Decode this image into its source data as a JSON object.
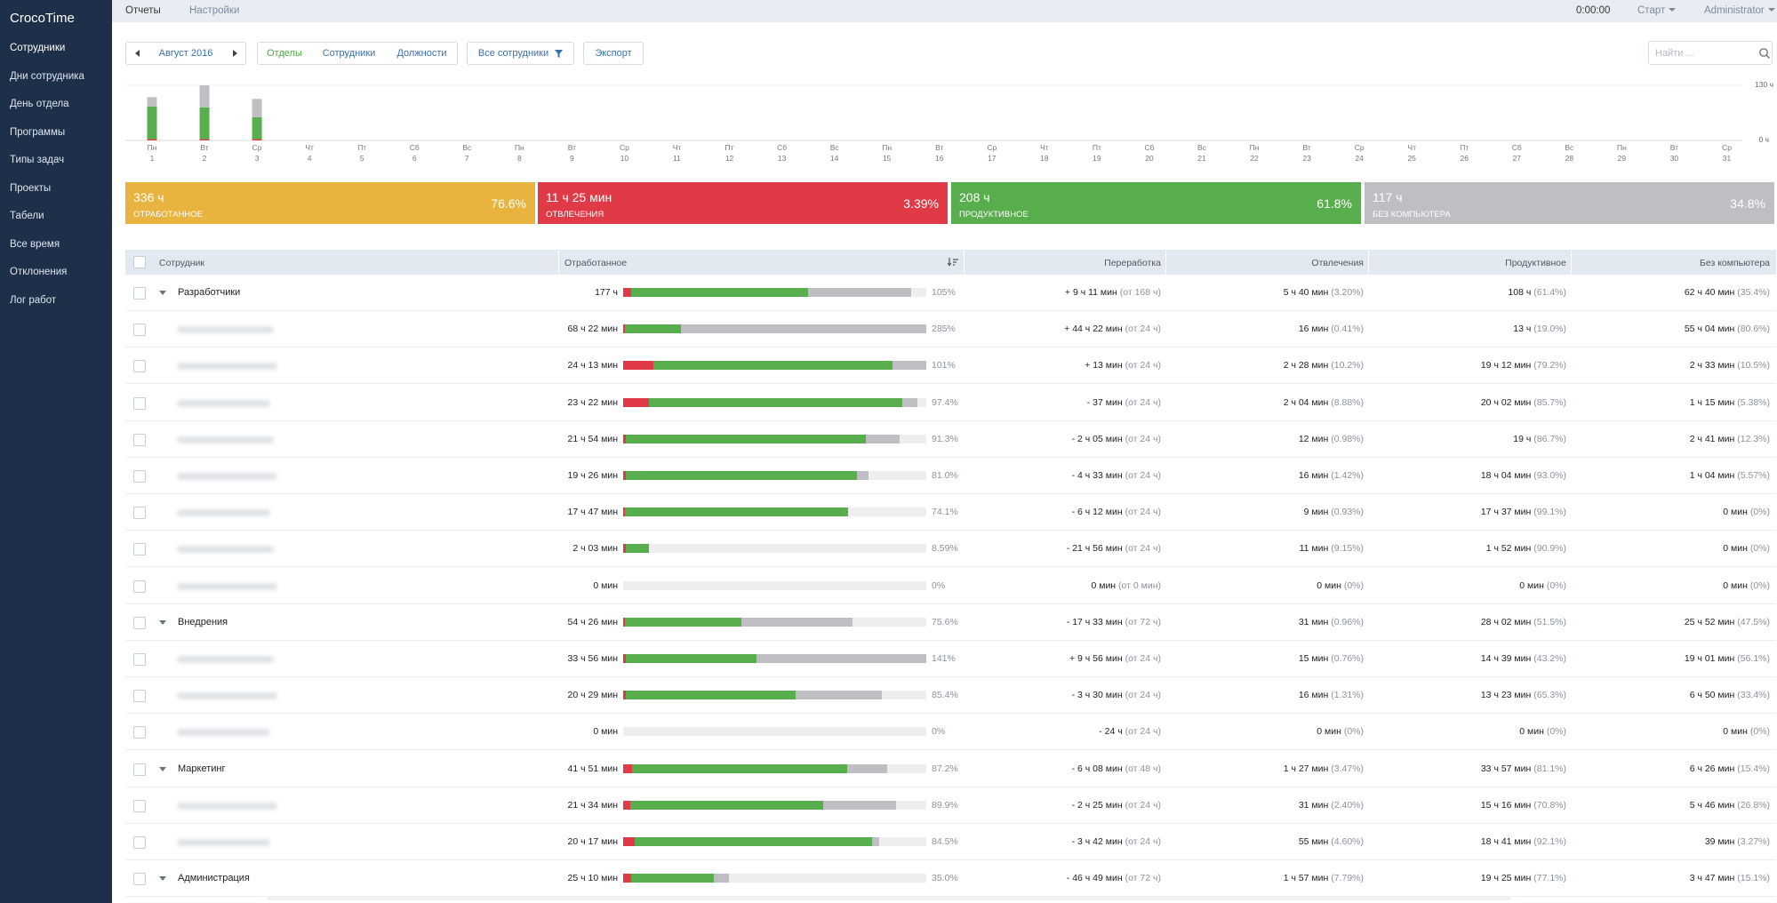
{
  "app": {
    "title": "CrocoTime"
  },
  "sidebar": {
    "items": [
      {
        "label": "Сотрудники",
        "active": true
      },
      {
        "label": "Дни сотрудника"
      },
      {
        "label": "День отдела"
      },
      {
        "label": "Программы"
      },
      {
        "label": "Типы задач"
      },
      {
        "label": "Проекты"
      },
      {
        "label": "Табели"
      },
      {
        "label": "Все время"
      },
      {
        "label": "Отклонения"
      },
      {
        "label": "Лог работ"
      }
    ]
  },
  "topbar": {
    "tabs": [
      "Отчеты",
      "Настройки"
    ],
    "timer": "0:00:00",
    "start": "Старт",
    "user": "Administrator"
  },
  "toolbar": {
    "month": "Август 2016",
    "views": [
      "Отделы",
      "Сотрудники",
      "Должности"
    ],
    "filter": "Все сотрудники",
    "export": "Экспорт",
    "search_placeholder": "Найти ..."
  },
  "colors": {
    "work": "#e8b33e",
    "distraction": "#e03a46",
    "productive": "#58ad4c",
    "no_computer": "#bfbfc3"
  },
  "chart_data": {
    "type": "bar",
    "stacked": true,
    "ymax_label": "130 ч",
    "ymin_label": "0 ч",
    "ylim": [
      0,
      130
    ],
    "days": [
      {
        "dow": "Пн",
        "d": "1",
        "distraction": 3,
        "productive": 77,
        "no_computer": 22
      },
      {
        "dow": "Вт",
        "d": "2",
        "distraction": 3,
        "productive": 75,
        "no_computer": 52
      },
      {
        "dow": "Ср",
        "d": "3",
        "distraction": 3,
        "productive": 52,
        "no_computer": 43
      },
      {
        "dow": "Чт",
        "d": "4"
      },
      {
        "dow": "Пт",
        "d": "5"
      },
      {
        "dow": "Сб",
        "d": "6"
      },
      {
        "dow": "Вс",
        "d": "7"
      },
      {
        "dow": "Пн",
        "d": "8"
      },
      {
        "dow": "Вт",
        "d": "9"
      },
      {
        "dow": "Ср",
        "d": "10"
      },
      {
        "dow": "Чт",
        "d": "11"
      },
      {
        "dow": "Пт",
        "d": "12"
      },
      {
        "dow": "Сб",
        "d": "13"
      },
      {
        "dow": "Вс",
        "d": "14"
      },
      {
        "dow": "Пн",
        "d": "15"
      },
      {
        "dow": "Вт",
        "d": "16"
      },
      {
        "dow": "Ср",
        "d": "17"
      },
      {
        "dow": "Чт",
        "d": "18"
      },
      {
        "dow": "Пт",
        "d": "19"
      },
      {
        "dow": "Сб",
        "d": "20"
      },
      {
        "dow": "Вс",
        "d": "21"
      },
      {
        "dow": "Пн",
        "d": "22"
      },
      {
        "dow": "Вт",
        "d": "23"
      },
      {
        "dow": "Ср",
        "d": "24"
      },
      {
        "dow": "Чт",
        "d": "25"
      },
      {
        "dow": "Пт",
        "d": "26"
      },
      {
        "dow": "Сб",
        "d": "27"
      },
      {
        "dow": "Вс",
        "d": "28"
      },
      {
        "dow": "Пн",
        "d": "29"
      },
      {
        "dow": "Вт",
        "d": "30"
      },
      {
        "dow": "Ср",
        "d": "31"
      }
    ]
  },
  "summary": [
    {
      "value": "336 ч",
      "label": "Отработанное",
      "percent": "76.6%",
      "color": "#e8b33e"
    },
    {
      "value": "11 ч 25 мин",
      "label": "Отвлечения",
      "percent": "3.39%",
      "color": "#e03a46"
    },
    {
      "value": "208 ч",
      "label": "Продуктивное",
      "percent": "61.8%",
      "color": "#58ad4c"
    },
    {
      "value": "117 ч",
      "label": "Без компьютера",
      "percent": "34.8%",
      "color": "#bfbfc3"
    }
  ],
  "table": {
    "columns": [
      "Сотрудник",
      "Отработанное",
      "Переработка",
      "Отвлечения",
      "Продуктивное",
      "Без компьютера"
    ],
    "rows": [
      {
        "group": true,
        "name": "Разработчики",
        "worked": "177 ч",
        "bar": [
          0.025,
          0.61,
          0.95
        ],
        "pct": "105%",
        "over": "+ 9 ч 11 мин",
        "over_base": "(от 168 ч)",
        "dist": "5 ч 40 мин",
        "dist_pct": "(3.20%)",
        "prod": "108 ч",
        "prod_pct": "(61.4%)",
        "nc": "62 ч 40 мин",
        "nc_pct": "(35.4%)"
      },
      {
        "group": false,
        "worked": "68 ч 22 мин",
        "bar": [
          0.005,
          0.19,
          1
        ],
        "pct": "285%",
        "over": "+ 44 ч 22 мин",
        "over_base": "(от 24 ч)",
        "dist": "16 мин",
        "dist_pct": "(0.41%)",
        "prod": "13 ч",
        "prod_pct": "(19.0%)",
        "nc": "55 ч 04 мин",
        "nc_pct": "(80.6%)"
      },
      {
        "group": false,
        "worked": "24 ч 13 мин",
        "bar": [
          0.1,
          0.89,
          1
        ],
        "pct": "101%",
        "over": "+ 13 мин",
        "over_base": "(от 24 ч)",
        "dist": "2 ч 28 мин",
        "dist_pct": "(10.2%)",
        "prod": "19 ч 12 мин",
        "prod_pct": "(79.2%)",
        "nc": "2 ч 33 мин",
        "nc_pct": "(10.5%)"
      },
      {
        "group": false,
        "worked": "23 ч 22 мин",
        "bar": [
          0.085,
          0.92,
          0.97
        ],
        "pct": "97.4%",
        "over": "- 37 мин",
        "over_base": "(от 24 ч)",
        "dist": "2 ч 04 мин",
        "dist_pct": "(8.88%)",
        "prod": "20 ч 02 мин",
        "prod_pct": "(85.7%)",
        "nc": "1 ч 15 мин",
        "nc_pct": "(5.38%)"
      },
      {
        "group": false,
        "worked": "21 ч 54 мин",
        "bar": [
          0.008,
          0.8,
          0.913
        ],
        "pct": "91.3%",
        "over": "- 2 ч 05 мин",
        "over_base": "(от 24 ч)",
        "dist": "12 мин",
        "dist_pct": "(0.98%)",
        "prod": "19 ч",
        "prod_pct": "(86.7%)",
        "nc": "2 ч 41 мин",
        "nc_pct": "(12.3%)"
      },
      {
        "group": false,
        "worked": "19 ч 26 мин",
        "bar": [
          0.01,
          0.77,
          0.81
        ],
        "pct": "81.0%",
        "over": "- 4 ч 33 мин",
        "over_base": "(от 24 ч)",
        "dist": "16 мин",
        "dist_pct": "(1.42%)",
        "prod": "18 ч 04 мин",
        "prod_pct": "(93.0%)",
        "nc": "1 ч 04 мин",
        "nc_pct": "(5.57%)"
      },
      {
        "group": false,
        "worked": "17 ч 47 мин",
        "bar": [
          0.007,
          0.741,
          0.741
        ],
        "pct": "74.1%",
        "over": "- 6 ч 12 мин",
        "over_base": "(от 24 ч)",
        "dist": "9 мин",
        "dist_pct": "(0.93%)",
        "prod": "17 ч 37 мин",
        "prod_pct": "(99.1%)",
        "nc": "0 мин",
        "nc_pct": "(0%)"
      },
      {
        "group": false,
        "worked": "2 ч 03 мин",
        "bar": [
          0.008,
          0.086,
          0.086
        ],
        "pct": "8.59%",
        "over": "- 21 ч 56 мин",
        "over_base": "(от 24 ч)",
        "dist": "11 мин",
        "dist_pct": "(9.15%)",
        "prod": "1 ч 52 мин",
        "prod_pct": "(90.9%)",
        "nc": "0 мин",
        "nc_pct": "(0%)"
      },
      {
        "group": false,
        "worked": "0 мин",
        "bar": [
          0,
          0,
          0
        ],
        "pct": "0%",
        "over": "0 мин",
        "over_base": "(от 0 мин)",
        "dist": "0 мин",
        "dist_pct": "(0%)",
        "prod": "0 мин",
        "prod_pct": "(0%)",
        "nc": "0 мин",
        "nc_pct": "(0%)"
      },
      {
        "group": true,
        "name": "Внедрения",
        "worked": "54 ч 26 мин",
        "bar": [
          0.007,
          0.39,
          0.756
        ],
        "pct": "75.6%",
        "over": "- 17 ч 33 мин",
        "over_base": "(от 72 ч)",
        "dist": "31 мин",
        "dist_pct": "(0.96%)",
        "prod": "28 ч 02 мин",
        "prod_pct": "(51.5%)",
        "nc": "25 ч 52 мин",
        "nc_pct": "(47.5%)"
      },
      {
        "group": false,
        "worked": "33 ч 56 мин",
        "bar": [
          0.008,
          0.44,
          1
        ],
        "pct": "141%",
        "over": "+ 9 ч 56 мин",
        "over_base": "(от 24 ч)",
        "dist": "15 мин",
        "dist_pct": "(0.76%)",
        "prod": "14 ч 39 мин",
        "prod_pct": "(43.2%)",
        "nc": "19 ч 01 мин",
        "nc_pct": "(56.1%)"
      },
      {
        "group": false,
        "worked": "20 ч 29 мин",
        "bar": [
          0.01,
          0.57,
          0.854
        ],
        "pct": "85.4%",
        "over": "- 3 ч 30 мин",
        "over_base": "(от 24 ч)",
        "dist": "16 мин",
        "dist_pct": "(1.31%)",
        "prod": "13 ч 23 мин",
        "prod_pct": "(65.3%)",
        "nc": "6 ч 50 мин",
        "nc_pct": "(33.4%)"
      },
      {
        "group": false,
        "worked": "0 мин",
        "bar": [
          0,
          0,
          0
        ],
        "pct": "0%",
        "over": "- 24 ч",
        "over_base": "(от 24 ч)",
        "dist": "0 мин",
        "dist_pct": "(0%)",
        "prod": "0 мин",
        "prod_pct": "(0%)",
        "nc": "0 мин",
        "nc_pct": "(0%)"
      },
      {
        "group": true,
        "name": "Маркетинг",
        "worked": "41 ч 51 мин",
        "bar": [
          0.03,
          0.74,
          0.872
        ],
        "pct": "87.2%",
        "over": "- 6 ч 08 мин",
        "over_base": "(от 48 ч)",
        "dist": "1 ч 27 мин",
        "dist_pct": "(3.47%)",
        "prod": "33 ч 57 мин",
        "prod_pct": "(81.1%)",
        "nc": "6 ч 26 мин",
        "nc_pct": "(15.4%)"
      },
      {
        "group": false,
        "worked": "21 ч 34 мин",
        "bar": [
          0.022,
          0.66,
          0.899
        ],
        "pct": "89.9%",
        "over": "- 2 ч 25 мин",
        "over_base": "(от 24 ч)",
        "dist": "31 мин",
        "dist_pct": "(2.40%)",
        "prod": "15 ч 16 мин",
        "prod_pct": "(70.8%)",
        "nc": "5 ч 46 мин",
        "nc_pct": "(26.8%)"
      },
      {
        "group": false,
        "worked": "20 ч 17 мин",
        "bar": [
          0.039,
          0.82,
          0.845
        ],
        "pct": "84.5%",
        "over": "- 3 ч 42 мин",
        "over_base": "(от 24 ч)",
        "dist": "55 мин",
        "dist_pct": "(4.60%)",
        "prod": "18 ч 41 мин",
        "prod_pct": "(92.1%)",
        "nc": "39 мин",
        "nc_pct": "(3.27%)"
      },
      {
        "group": true,
        "name": "Администрация",
        "worked": "25 ч 10 мин",
        "bar": [
          0.027,
          0.3,
          0.35
        ],
        "pct": "35.0%",
        "over": "- 46 ч 49 мин",
        "over_base": "(от 72 ч)",
        "dist": "1 ч 57 мин",
        "dist_pct": "(7.79%)",
        "prod": "19 ч 25 мин",
        "prod_pct": "(77.1%)",
        "nc": "3 ч 47 мин",
        "nc_pct": "(15.1%)"
      }
    ]
  }
}
